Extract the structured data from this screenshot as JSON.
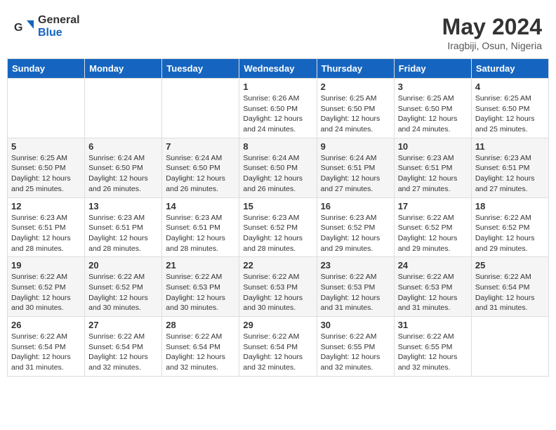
{
  "logo": {
    "text_general": "General",
    "text_blue": "Blue"
  },
  "title": {
    "month_year": "May 2024",
    "location": "Iragbiji, Osun, Nigeria"
  },
  "weekdays": [
    "Sunday",
    "Monday",
    "Tuesday",
    "Wednesday",
    "Thursday",
    "Friday",
    "Saturday"
  ],
  "weeks": [
    [
      {
        "day": "",
        "info": ""
      },
      {
        "day": "",
        "info": ""
      },
      {
        "day": "",
        "info": ""
      },
      {
        "day": "1",
        "info": "Sunrise: 6:26 AM\nSunset: 6:50 PM\nDaylight: 12 hours\nand 24 minutes."
      },
      {
        "day": "2",
        "info": "Sunrise: 6:25 AM\nSunset: 6:50 PM\nDaylight: 12 hours\nand 24 minutes."
      },
      {
        "day": "3",
        "info": "Sunrise: 6:25 AM\nSunset: 6:50 PM\nDaylight: 12 hours\nand 24 minutes."
      },
      {
        "day": "4",
        "info": "Sunrise: 6:25 AM\nSunset: 6:50 PM\nDaylight: 12 hours\nand 25 minutes."
      }
    ],
    [
      {
        "day": "5",
        "info": "Sunrise: 6:25 AM\nSunset: 6:50 PM\nDaylight: 12 hours\nand 25 minutes."
      },
      {
        "day": "6",
        "info": "Sunrise: 6:24 AM\nSunset: 6:50 PM\nDaylight: 12 hours\nand 26 minutes."
      },
      {
        "day": "7",
        "info": "Sunrise: 6:24 AM\nSunset: 6:50 PM\nDaylight: 12 hours\nand 26 minutes."
      },
      {
        "day": "8",
        "info": "Sunrise: 6:24 AM\nSunset: 6:50 PM\nDaylight: 12 hours\nand 26 minutes."
      },
      {
        "day": "9",
        "info": "Sunrise: 6:24 AM\nSunset: 6:51 PM\nDaylight: 12 hours\nand 27 minutes."
      },
      {
        "day": "10",
        "info": "Sunrise: 6:23 AM\nSunset: 6:51 PM\nDaylight: 12 hours\nand 27 minutes."
      },
      {
        "day": "11",
        "info": "Sunrise: 6:23 AM\nSunset: 6:51 PM\nDaylight: 12 hours\nand 27 minutes."
      }
    ],
    [
      {
        "day": "12",
        "info": "Sunrise: 6:23 AM\nSunset: 6:51 PM\nDaylight: 12 hours\nand 28 minutes."
      },
      {
        "day": "13",
        "info": "Sunrise: 6:23 AM\nSunset: 6:51 PM\nDaylight: 12 hours\nand 28 minutes."
      },
      {
        "day": "14",
        "info": "Sunrise: 6:23 AM\nSunset: 6:51 PM\nDaylight: 12 hours\nand 28 minutes."
      },
      {
        "day": "15",
        "info": "Sunrise: 6:23 AM\nSunset: 6:52 PM\nDaylight: 12 hours\nand 28 minutes."
      },
      {
        "day": "16",
        "info": "Sunrise: 6:23 AM\nSunset: 6:52 PM\nDaylight: 12 hours\nand 29 minutes."
      },
      {
        "day": "17",
        "info": "Sunrise: 6:22 AM\nSunset: 6:52 PM\nDaylight: 12 hours\nand 29 minutes."
      },
      {
        "day": "18",
        "info": "Sunrise: 6:22 AM\nSunset: 6:52 PM\nDaylight: 12 hours\nand 29 minutes."
      }
    ],
    [
      {
        "day": "19",
        "info": "Sunrise: 6:22 AM\nSunset: 6:52 PM\nDaylight: 12 hours\nand 30 minutes."
      },
      {
        "day": "20",
        "info": "Sunrise: 6:22 AM\nSunset: 6:52 PM\nDaylight: 12 hours\nand 30 minutes."
      },
      {
        "day": "21",
        "info": "Sunrise: 6:22 AM\nSunset: 6:53 PM\nDaylight: 12 hours\nand 30 minutes."
      },
      {
        "day": "22",
        "info": "Sunrise: 6:22 AM\nSunset: 6:53 PM\nDaylight: 12 hours\nand 30 minutes."
      },
      {
        "day": "23",
        "info": "Sunrise: 6:22 AM\nSunset: 6:53 PM\nDaylight: 12 hours\nand 31 minutes."
      },
      {
        "day": "24",
        "info": "Sunrise: 6:22 AM\nSunset: 6:53 PM\nDaylight: 12 hours\nand 31 minutes."
      },
      {
        "day": "25",
        "info": "Sunrise: 6:22 AM\nSunset: 6:54 PM\nDaylight: 12 hours\nand 31 minutes."
      }
    ],
    [
      {
        "day": "26",
        "info": "Sunrise: 6:22 AM\nSunset: 6:54 PM\nDaylight: 12 hours\nand 31 minutes."
      },
      {
        "day": "27",
        "info": "Sunrise: 6:22 AM\nSunset: 6:54 PM\nDaylight: 12 hours\nand 32 minutes."
      },
      {
        "day": "28",
        "info": "Sunrise: 6:22 AM\nSunset: 6:54 PM\nDaylight: 12 hours\nand 32 minutes."
      },
      {
        "day": "29",
        "info": "Sunrise: 6:22 AM\nSunset: 6:54 PM\nDaylight: 12 hours\nand 32 minutes."
      },
      {
        "day": "30",
        "info": "Sunrise: 6:22 AM\nSunset: 6:55 PM\nDaylight: 12 hours\nand 32 minutes."
      },
      {
        "day": "31",
        "info": "Sunrise: 6:22 AM\nSunset: 6:55 PM\nDaylight: 12 hours\nand 32 minutes."
      },
      {
        "day": "",
        "info": ""
      }
    ]
  ]
}
